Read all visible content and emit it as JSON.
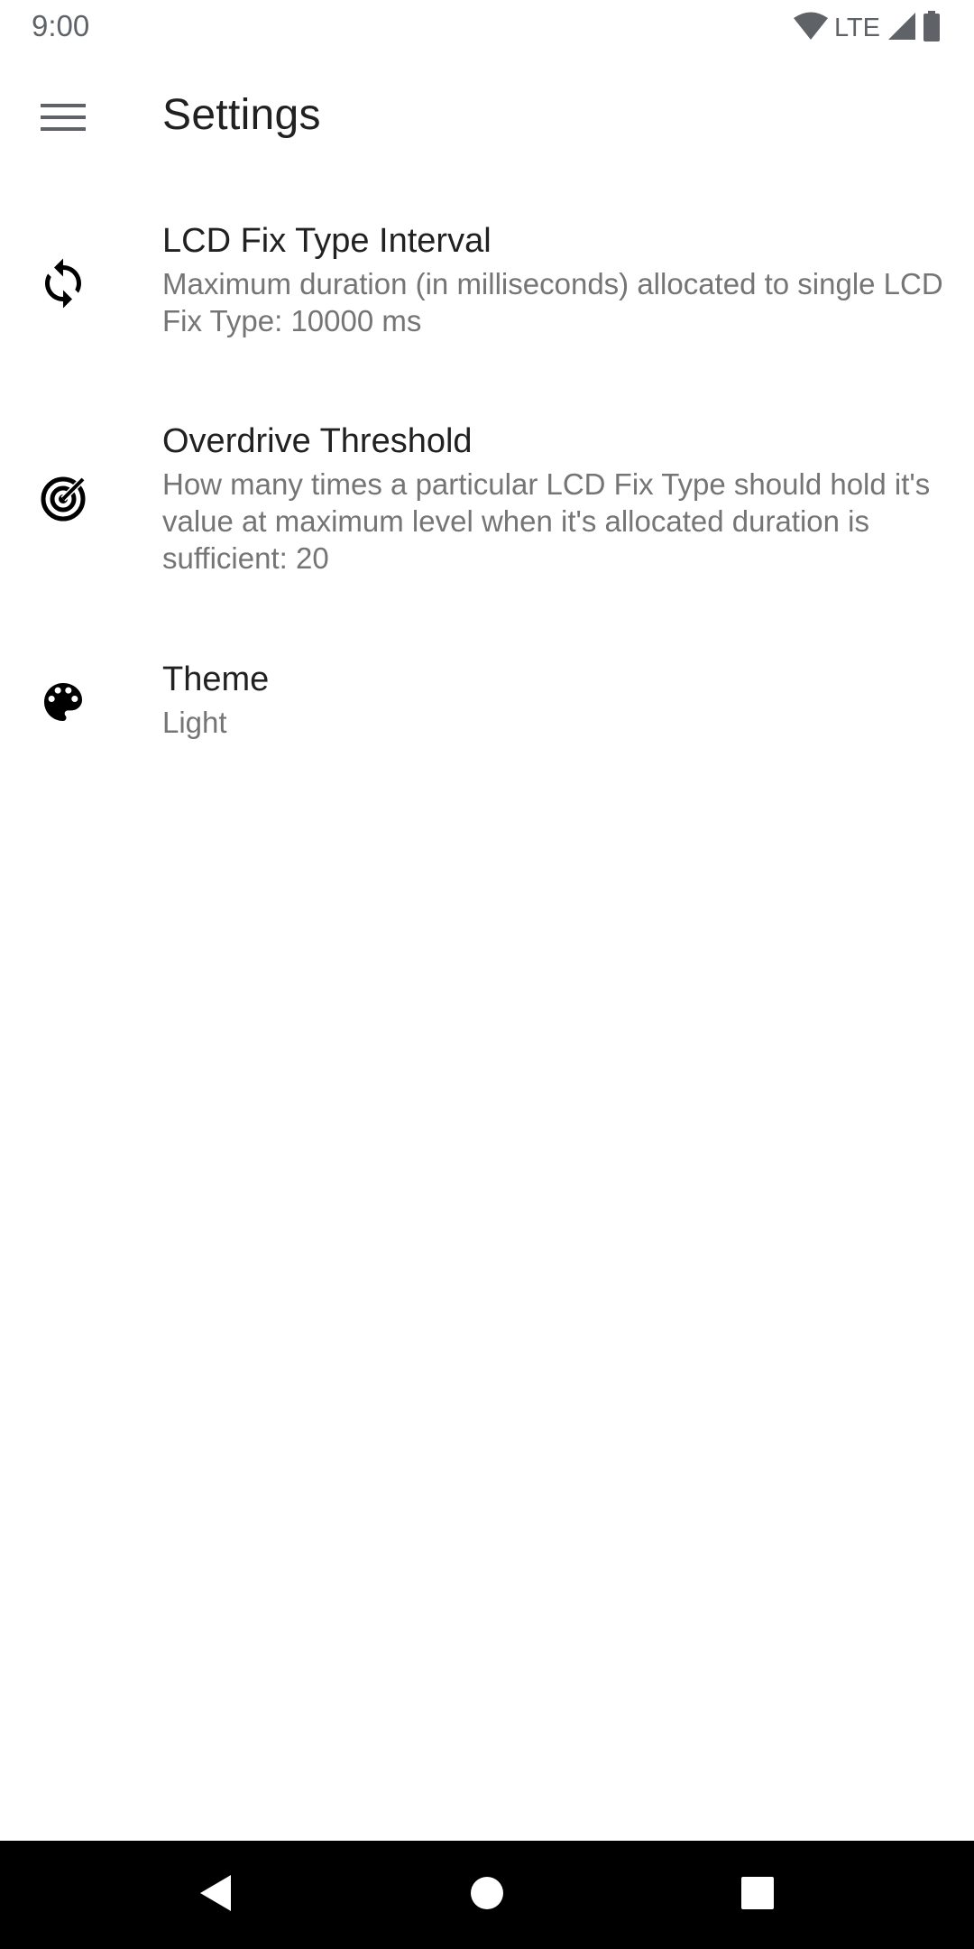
{
  "status_bar": {
    "time": "9:00",
    "network_label": "LTE",
    "icons": [
      "wifi-icon",
      "cell-signal-icon",
      "battery-icon"
    ]
  },
  "app_bar": {
    "menu_icon": "hamburger-menu-icon",
    "title": "Settings"
  },
  "preferences": [
    {
      "icon": "sync-icon",
      "title": "LCD Fix Type Interval",
      "summary": "Maximum duration (in milliseconds) allocated to single LCD Fix Type: 10000 ms"
    },
    {
      "icon": "target-icon",
      "title": "Overdrive Threshold",
      "summary": "How many times a particular LCD Fix Type should hold it's value at maximum level when it's allocated duration is sufficient: 20"
    },
    {
      "icon": "palette-icon",
      "title": "Theme",
      "summary": "Light"
    }
  ],
  "nav_bar": {
    "buttons": [
      "back-icon",
      "home-icon",
      "recents-icon"
    ]
  },
  "colors": {
    "title_text": "#212121",
    "summary_text": "#757575",
    "status_text": "#5f6368",
    "nav_background": "#000000"
  }
}
